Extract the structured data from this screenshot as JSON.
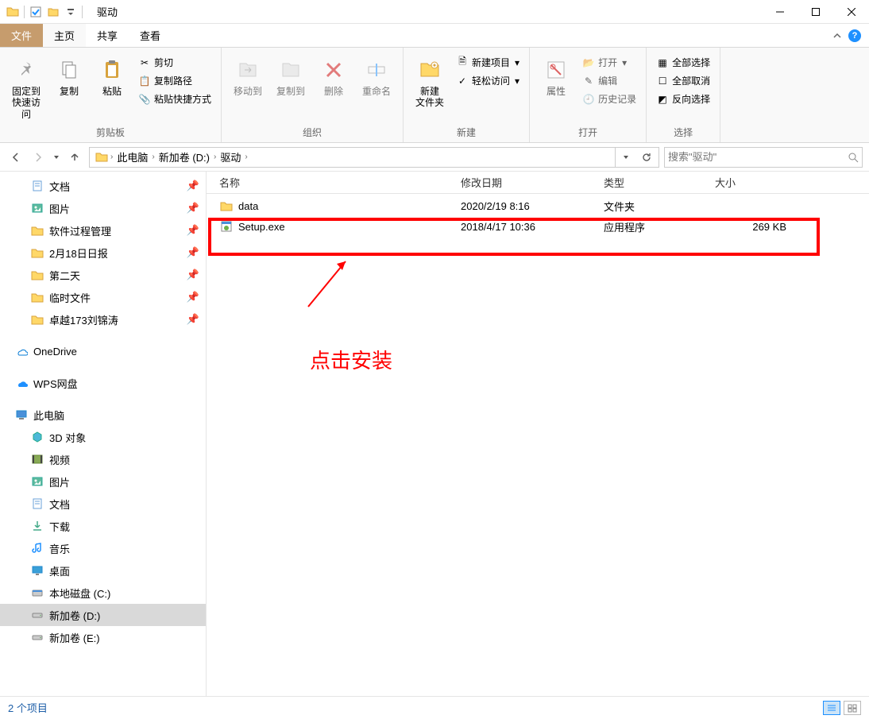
{
  "window": {
    "title": "驱动"
  },
  "tabs": {
    "file": "文件",
    "home": "主页",
    "share": "共享",
    "view": "查看"
  },
  "ribbon": {
    "clipboard": {
      "label": "剪贴板",
      "pin": {
        "label": "固定到\n快速访问"
      },
      "copy": "复制",
      "paste": "粘贴",
      "cut": "剪切",
      "copypath": "复制路径",
      "pasteshortcut": "粘贴快捷方式"
    },
    "organize": {
      "label": "组织",
      "moveto": "移动到",
      "copyto": "复制到",
      "delete": "删除",
      "rename": "重命名"
    },
    "new": {
      "label": "新建",
      "newfolder": "新建\n文件夹",
      "newitem": "新建项目",
      "easyaccess": "轻松访问"
    },
    "open": {
      "label": "打开",
      "properties": "属性",
      "open": "打开",
      "edit": "编辑",
      "history": "历史记录"
    },
    "select": {
      "label": "选择",
      "selectall": "全部选择",
      "selectnone": "全部取消",
      "invert": "反向选择"
    }
  },
  "breadcrumb": [
    "此电脑",
    "新加卷 (D:)",
    "驱动"
  ],
  "search": {
    "placeholder": "搜索\"驱动\""
  },
  "sidebar": {
    "pinned": [
      {
        "label": "文档",
        "icon": "document"
      },
      {
        "label": "图片",
        "icon": "picture"
      },
      {
        "label": "软件过程管理",
        "icon": "folder"
      },
      {
        "label": "2月18日日报",
        "icon": "folder"
      },
      {
        "label": "第二天",
        "icon": "folder"
      },
      {
        "label": "临时文件",
        "icon": "folder"
      },
      {
        "label": "卓越173刘锦涛",
        "icon": "folder"
      }
    ],
    "onedrive": "OneDrive",
    "wps": "WPS网盘",
    "thispc": "此电脑",
    "pcitems": [
      {
        "label": "3D 对象",
        "icon": "3d"
      },
      {
        "label": "视频",
        "icon": "video"
      },
      {
        "label": "图片",
        "icon": "picture"
      },
      {
        "label": "文档",
        "icon": "document"
      },
      {
        "label": "下载",
        "icon": "download"
      },
      {
        "label": "音乐",
        "icon": "music"
      },
      {
        "label": "桌面",
        "icon": "desktop"
      },
      {
        "label": "本地磁盘 (C:)",
        "icon": "drive-c"
      },
      {
        "label": "新加卷 (D:)",
        "icon": "drive",
        "selected": true
      },
      {
        "label": "新加卷 (E:)",
        "icon": "drive"
      }
    ]
  },
  "columns": {
    "name": "名称",
    "date": "修改日期",
    "type": "类型",
    "size": "大小"
  },
  "files": [
    {
      "name": "data",
      "date": "2020/2/19 8:16",
      "type": "文件夹",
      "size": "",
      "icon": "folder"
    },
    {
      "name": "Setup.exe",
      "date": "2018/4/17 10:36",
      "type": "应用程序",
      "size": "269 KB",
      "icon": "exe"
    }
  ],
  "annotation": {
    "text": "点击安装"
  },
  "status": {
    "items": "2 个项目"
  }
}
